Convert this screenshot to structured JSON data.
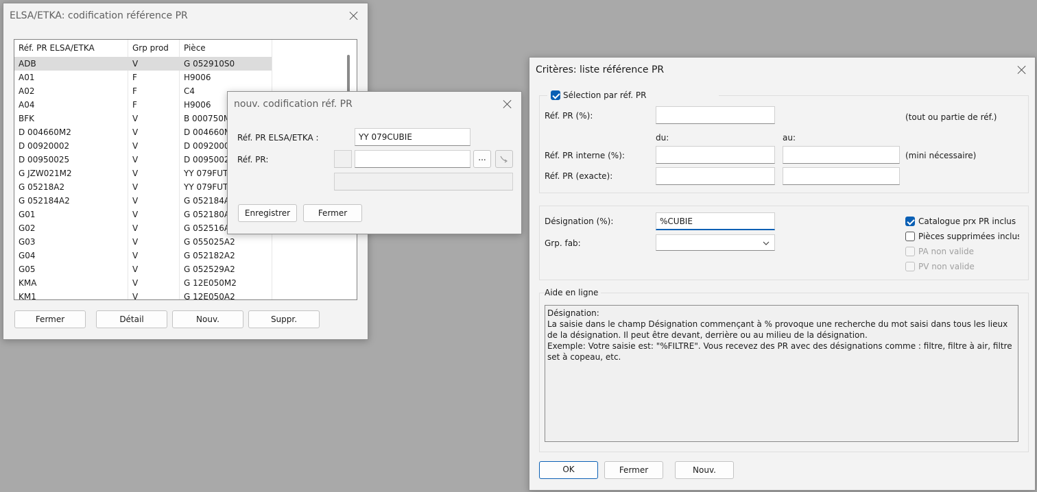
{
  "left_window": {
    "title": "ELSA/ETKA: codification référence PR",
    "columns": [
      "Réf. PR ELSA/ETKA",
      "Grp prod",
      "Pièce"
    ],
    "rows": [
      [
        "ADB",
        "V",
        "G  052910S0"
      ],
      [
        "A01",
        "F",
        "H9006"
      ],
      [
        "A02",
        "F",
        "C4"
      ],
      [
        "A04",
        "F",
        "H9006"
      ],
      [
        "BFK",
        "V",
        "B  000750M"
      ],
      [
        "D  004660M2",
        "V",
        "D  004660M"
      ],
      [
        "D  00920002",
        "V",
        "D  0092000"
      ],
      [
        "D  00950025",
        "V",
        "D  0095002"
      ],
      [
        "G  JZW021M2",
        "V",
        "YY 079FUT"
      ],
      [
        "G  05218A2",
        "V",
        "YY 079FUT"
      ],
      [
        "G  052184A2",
        "V",
        "G  052184A"
      ],
      [
        "G01",
        "V",
        "G  052180A"
      ],
      [
        "G02",
        "V",
        "G  052516A"
      ],
      [
        "G03",
        "V",
        "G  055025A2"
      ],
      [
        "G04",
        "V",
        "G  052182A2"
      ],
      [
        "G05",
        "V",
        "G  052529A2"
      ],
      [
        "KMA",
        "V",
        "G  12E050M2"
      ],
      [
        "KM1",
        "V",
        "G  12E050A2"
      ]
    ],
    "buttons": {
      "close": "Fermer",
      "detail": "Détail",
      "new": "Nouv.",
      "delete": "Suppr."
    }
  },
  "mid_window": {
    "title": "nouv. codification réf. PR",
    "label_ref_elsa": "Réf. PR ELSA/ETKA :",
    "ref_elsa_value": "YY 079CUBIE",
    "label_ref_pr": "Réf. PR:",
    "browse_label": "...",
    "buttons": {
      "save": "Enregistrer",
      "close": "Fermer"
    }
  },
  "right_window": {
    "title": "Critères: liste référence PR",
    "selection_label": "Sélection par réf. PR",
    "ref_pr_pct_label": "Réf. PR (%):",
    "ref_pr_hint": "(tout ou partie de réf.)",
    "du_label": "du:",
    "au_label": "au:",
    "ref_interne_label": "Réf. PR interne (%):",
    "ref_interne_hint": "(mini nécessaire)",
    "ref_exacte_label": "Réf. PR (exacte):",
    "designation_label": "Désignation (%):",
    "designation_value": "%CUBIE",
    "grp_fab_label": "Grp. fab:",
    "cb_catalogue": "Catalogue prx PR inclus",
    "cb_pieces_supprimees": "Pièces supprimées incluses",
    "cb_pa_non_valide": "PA non valide",
    "cb_pv_non_valide": "PV non valide",
    "help_title": "Aide en ligne",
    "help_text": "Désignation:\nLa saisie dans le champ Désignation commençant à % provoque une recherche du mot saisi dans tous les lieux de la désignation. Il peut être devant, derrière ou au milieu de la désignation.\nExemple: Votre saisie est: \"%FILTRE\". Vous recevez des PR avec des désignations comme : filtre, filtre à air, filtre set à copeau, etc.",
    "buttons": {
      "ok": "OK",
      "close": "Fermer",
      "new": "Nouv."
    }
  },
  "colors": {
    "accent": "#0a5fb4",
    "desktop": "#a9a9a9",
    "window_bg": "#f3f3f3"
  }
}
